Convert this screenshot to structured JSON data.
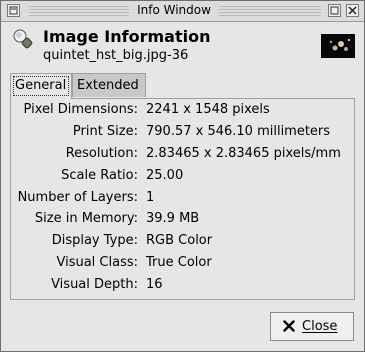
{
  "window": {
    "title": "Info Window",
    "icons": {
      "menu": "window-menu-icon",
      "minimize": "minimize-icon",
      "close": "close-icon"
    }
  },
  "header": {
    "icon": "image-info-icon",
    "title": "Image Information",
    "subtitle": "quintet_hst_big.jpg-36",
    "thumbnail": "image-thumbnail"
  },
  "tabs": [
    {
      "label": "General",
      "active": true
    },
    {
      "label": "Extended",
      "active": false
    }
  ],
  "info": [
    {
      "label": "Pixel Dimensions:",
      "value": "2241 x 1548 pixels"
    },
    {
      "label": "Print Size:",
      "value": "790.57 x 546.10 millimeters"
    },
    {
      "label": "Resolution:",
      "value": "2.83465 x 2.83465 pixels/mm"
    },
    {
      "label": "Scale Ratio:",
      "value": "25.00"
    },
    {
      "label": "Number of Layers:",
      "value": "1"
    },
    {
      "label": "Size in Memory:",
      "value": "39.9 MB"
    },
    {
      "label": "Display Type:",
      "value": "RGB Color"
    },
    {
      "label": "Visual Class:",
      "value": "True Color"
    },
    {
      "label": "Visual Depth:",
      "value": "16"
    }
  ],
  "buttons": {
    "close_label": "Close",
    "close_icon": "x-icon"
  },
  "colors": {
    "window_bg": "#e6e6e6",
    "titlebar_bg": "#dcdcdc",
    "inactive_tab": "#c8c8c8"
  }
}
